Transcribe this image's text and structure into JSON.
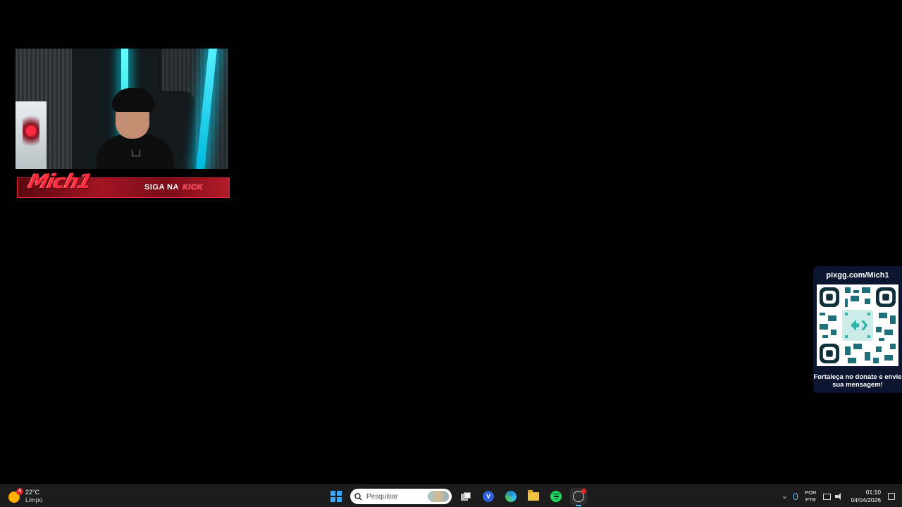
{
  "overlay": {
    "brand": "Mich1",
    "follow_prefix": "SIGA NA",
    "follow_platform": "KICK"
  },
  "donation": {
    "url": "pixgg.com/Mich1",
    "message": "Fortaleça no donate e envie sua mensagem!"
  },
  "taskbar": {
    "weather": {
      "temp": "22°C",
      "condition": "Limpo",
      "badge": "4"
    },
    "search_placeholder": "Pesquisar",
    "vpn_letter": "V",
    "language": {
      "line1": "POR",
      "line2": "PTB"
    },
    "clock": {
      "time": "01:10",
      "date": "04/04/2026"
    }
  },
  "colors": {
    "accent": "#ff2d3e",
    "qr_card": "#0c1530",
    "taskbar": "#1c1c1c",
    "windows_blue": "#3aa8ff"
  }
}
